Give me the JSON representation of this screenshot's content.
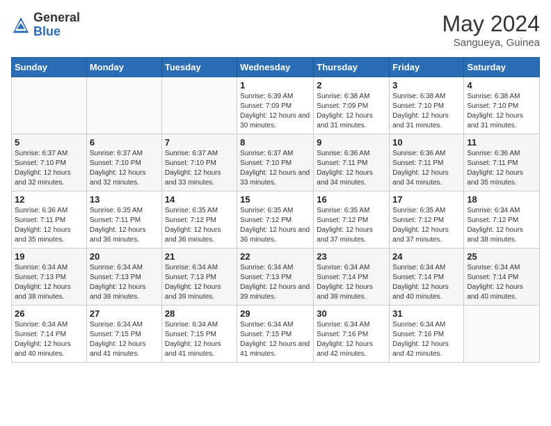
{
  "logo": {
    "general": "General",
    "blue": "Blue"
  },
  "title": {
    "month_year": "May 2024",
    "location": "Sangueya, Guinea"
  },
  "headers": [
    "Sunday",
    "Monday",
    "Tuesday",
    "Wednesday",
    "Thursday",
    "Friday",
    "Saturday"
  ],
  "weeks": [
    [
      {
        "day": "",
        "info": ""
      },
      {
        "day": "",
        "info": ""
      },
      {
        "day": "",
        "info": ""
      },
      {
        "day": "1",
        "info": "Sunrise: 6:39 AM\nSunset: 7:09 PM\nDaylight: 12 hours and 30 minutes."
      },
      {
        "day": "2",
        "info": "Sunrise: 6:38 AM\nSunset: 7:09 PM\nDaylight: 12 hours and 31 minutes."
      },
      {
        "day": "3",
        "info": "Sunrise: 6:38 AM\nSunset: 7:10 PM\nDaylight: 12 hours and 31 minutes."
      },
      {
        "day": "4",
        "info": "Sunrise: 6:38 AM\nSunset: 7:10 PM\nDaylight: 12 hours and 31 minutes."
      }
    ],
    [
      {
        "day": "5",
        "info": "Sunrise: 6:37 AM\nSunset: 7:10 PM\nDaylight: 12 hours and 32 minutes."
      },
      {
        "day": "6",
        "info": "Sunrise: 6:37 AM\nSunset: 7:10 PM\nDaylight: 12 hours and 32 minutes."
      },
      {
        "day": "7",
        "info": "Sunrise: 6:37 AM\nSunset: 7:10 PM\nDaylight: 12 hours and 33 minutes."
      },
      {
        "day": "8",
        "info": "Sunrise: 6:37 AM\nSunset: 7:10 PM\nDaylight: 12 hours and 33 minutes."
      },
      {
        "day": "9",
        "info": "Sunrise: 6:36 AM\nSunset: 7:11 PM\nDaylight: 12 hours and 34 minutes."
      },
      {
        "day": "10",
        "info": "Sunrise: 6:36 AM\nSunset: 7:11 PM\nDaylight: 12 hours and 34 minutes."
      },
      {
        "day": "11",
        "info": "Sunrise: 6:36 AM\nSunset: 7:11 PM\nDaylight: 12 hours and 35 minutes."
      }
    ],
    [
      {
        "day": "12",
        "info": "Sunrise: 6:36 AM\nSunset: 7:11 PM\nDaylight: 12 hours and 35 minutes."
      },
      {
        "day": "13",
        "info": "Sunrise: 6:35 AM\nSunset: 7:11 PM\nDaylight: 12 hours and 36 minutes."
      },
      {
        "day": "14",
        "info": "Sunrise: 6:35 AM\nSunset: 7:12 PM\nDaylight: 12 hours and 36 minutes."
      },
      {
        "day": "15",
        "info": "Sunrise: 6:35 AM\nSunset: 7:12 PM\nDaylight: 12 hours and 36 minutes."
      },
      {
        "day": "16",
        "info": "Sunrise: 6:35 AM\nSunset: 7:12 PM\nDaylight: 12 hours and 37 minutes."
      },
      {
        "day": "17",
        "info": "Sunrise: 6:35 AM\nSunset: 7:12 PM\nDaylight: 12 hours and 37 minutes."
      },
      {
        "day": "18",
        "info": "Sunrise: 6:34 AM\nSunset: 7:12 PM\nDaylight: 12 hours and 38 minutes."
      }
    ],
    [
      {
        "day": "19",
        "info": "Sunrise: 6:34 AM\nSunset: 7:13 PM\nDaylight: 12 hours and 38 minutes."
      },
      {
        "day": "20",
        "info": "Sunrise: 6:34 AM\nSunset: 7:13 PM\nDaylight: 12 hours and 38 minutes."
      },
      {
        "day": "21",
        "info": "Sunrise: 6:34 AM\nSunset: 7:13 PM\nDaylight: 12 hours and 39 minutes."
      },
      {
        "day": "22",
        "info": "Sunrise: 6:34 AM\nSunset: 7:13 PM\nDaylight: 12 hours and 39 minutes."
      },
      {
        "day": "23",
        "info": "Sunrise: 6:34 AM\nSunset: 7:14 PM\nDaylight: 12 hours and 39 minutes."
      },
      {
        "day": "24",
        "info": "Sunrise: 6:34 AM\nSunset: 7:14 PM\nDaylight: 12 hours and 40 minutes."
      },
      {
        "day": "25",
        "info": "Sunrise: 6:34 AM\nSunset: 7:14 PM\nDaylight: 12 hours and 40 minutes."
      }
    ],
    [
      {
        "day": "26",
        "info": "Sunrise: 6:34 AM\nSunset: 7:14 PM\nDaylight: 12 hours and 40 minutes."
      },
      {
        "day": "27",
        "info": "Sunrise: 6:34 AM\nSunset: 7:15 PM\nDaylight: 12 hours and 41 minutes."
      },
      {
        "day": "28",
        "info": "Sunrise: 6:34 AM\nSunset: 7:15 PM\nDaylight: 12 hours and 41 minutes."
      },
      {
        "day": "29",
        "info": "Sunrise: 6:34 AM\nSunset: 7:15 PM\nDaylight: 12 hours and 41 minutes."
      },
      {
        "day": "30",
        "info": "Sunrise: 6:34 AM\nSunset: 7:16 PM\nDaylight: 12 hours and 42 minutes."
      },
      {
        "day": "31",
        "info": "Sunrise: 6:34 AM\nSunset: 7:16 PM\nDaylight: 12 hours and 42 minutes."
      },
      {
        "day": "",
        "info": ""
      }
    ]
  ]
}
